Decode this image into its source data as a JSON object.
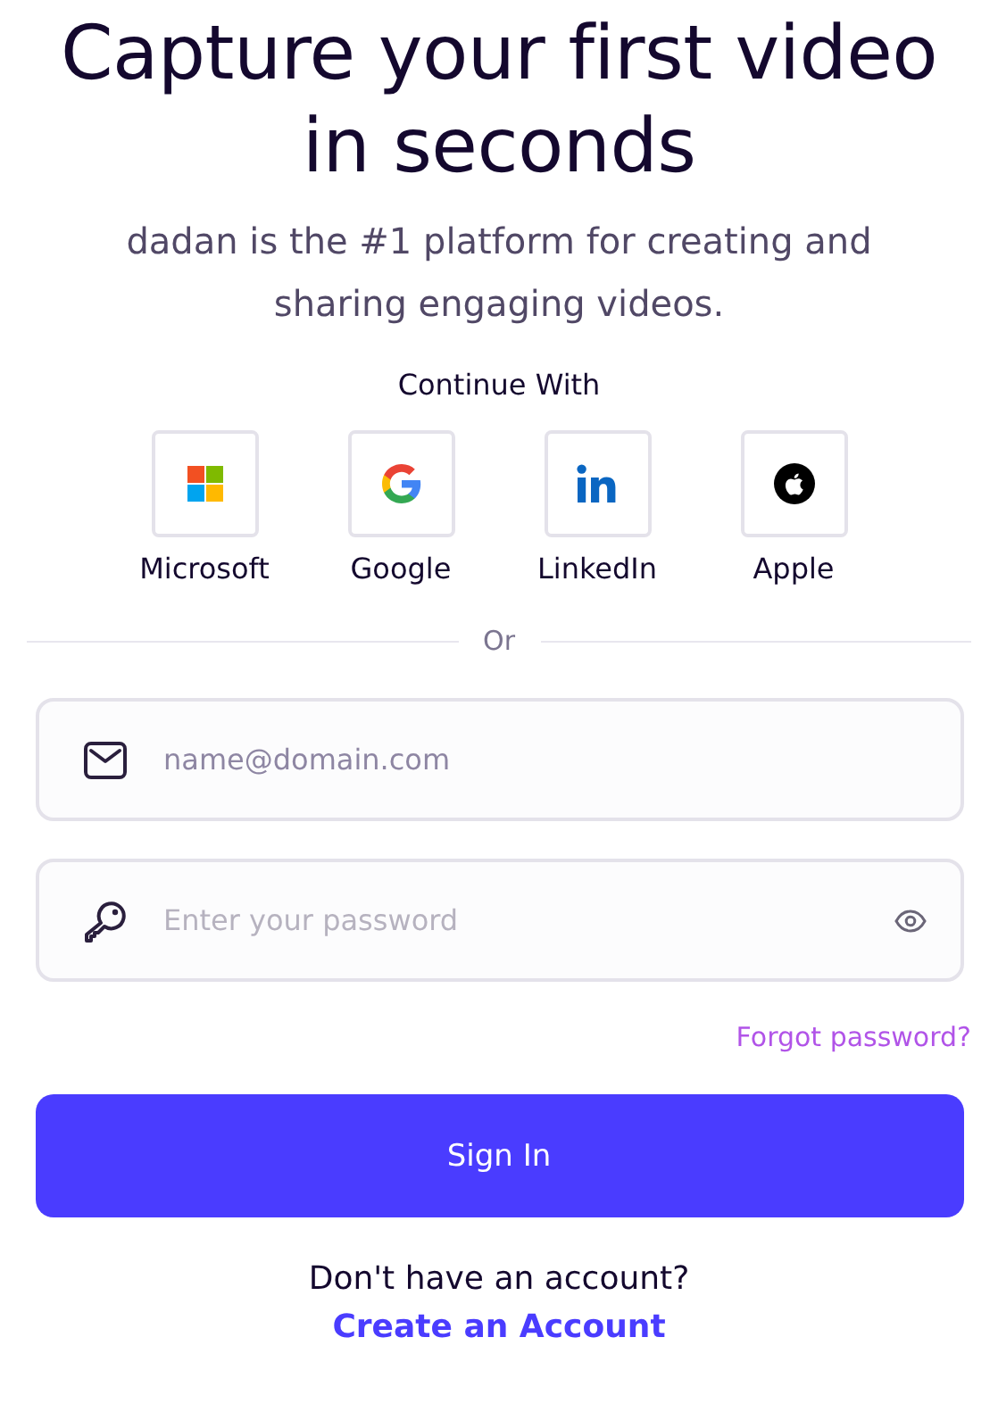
{
  "title": "Capture your first video in seconds",
  "subtitle": "dadan is the #1 platform for creating and sharing engaging videos.",
  "continue_label": "Continue With",
  "providers": [
    {
      "kind": "microsoft",
      "label": "Microsoft"
    },
    {
      "kind": "google",
      "label": "Google"
    },
    {
      "kind": "linkedin",
      "label": "LinkedIn"
    },
    {
      "kind": "apple",
      "label": "Apple"
    }
  ],
  "divider_label": "Or",
  "email_field": {
    "placeholder": "name@domain.com"
  },
  "password_field": {
    "placeholder": "Enter your password"
  },
  "forgot_link": "Forgot password?",
  "sign_in_button": "Sign In",
  "signup_prompt": "Don't have an account?",
  "signup_link": "Create an Account"
}
